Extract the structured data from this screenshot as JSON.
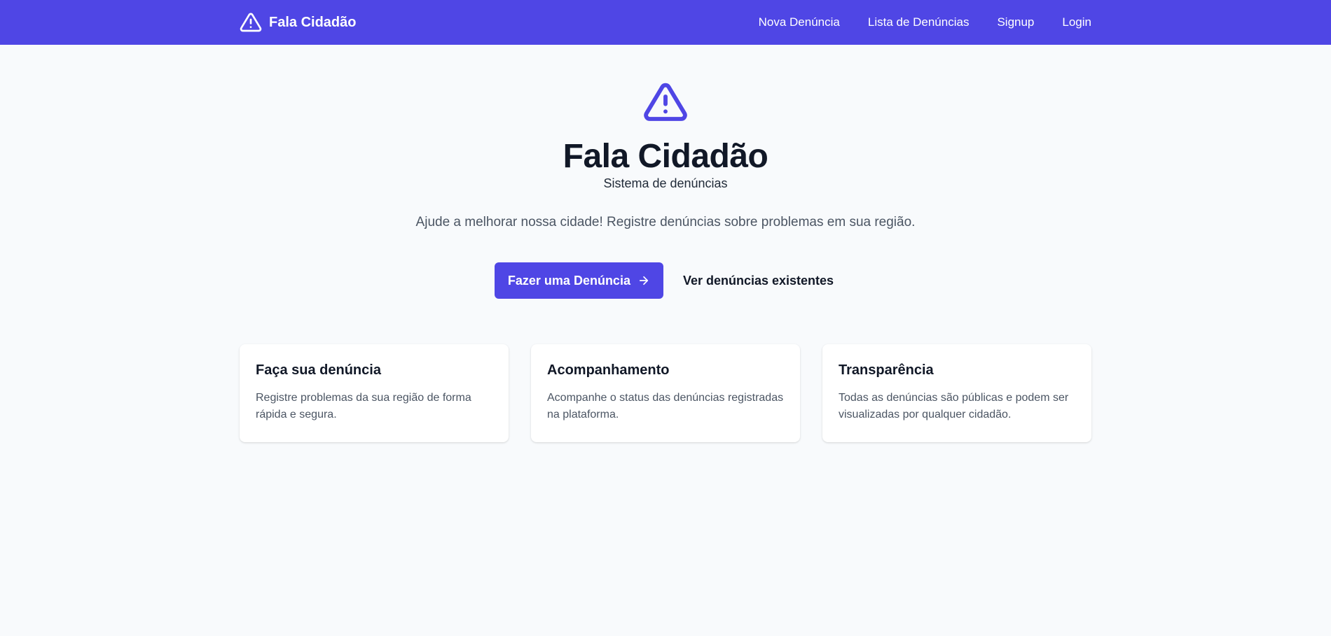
{
  "navbar": {
    "brand": "Fala Cidadão",
    "links": [
      "Nova Denúncia",
      "Lista de Denúncias",
      "Signup",
      "Login"
    ]
  },
  "hero": {
    "title": "Fala Cidadão",
    "subtitle": "Sistema de denúncias",
    "description": "Ajude a melhorar nossa cidade! Registre denúncias sobre problemas em sua região.",
    "primary_button": "Fazer uma Denúncia",
    "secondary_link": "Ver denúncias existentes"
  },
  "cards": [
    {
      "title": "Faça sua denúncia",
      "text": "Registre problemas da sua região de forma rápida e segura."
    },
    {
      "title": "Acompanhamento",
      "text": "Acompanhe o status das denúncias registradas na plataforma."
    },
    {
      "title": "Transparência",
      "text": "Todas as denúncias são públicas e podem ser visualizadas por qualquer cidadão."
    }
  ],
  "colors": {
    "primary": "#4f46e5",
    "background": "#f8fafc",
    "heading": "#111827",
    "muted_text": "#4b5563"
  },
  "icons": {
    "brand": "warning-triangle-icon",
    "hero": "warning-triangle-icon",
    "button": "arrow-right-icon"
  }
}
